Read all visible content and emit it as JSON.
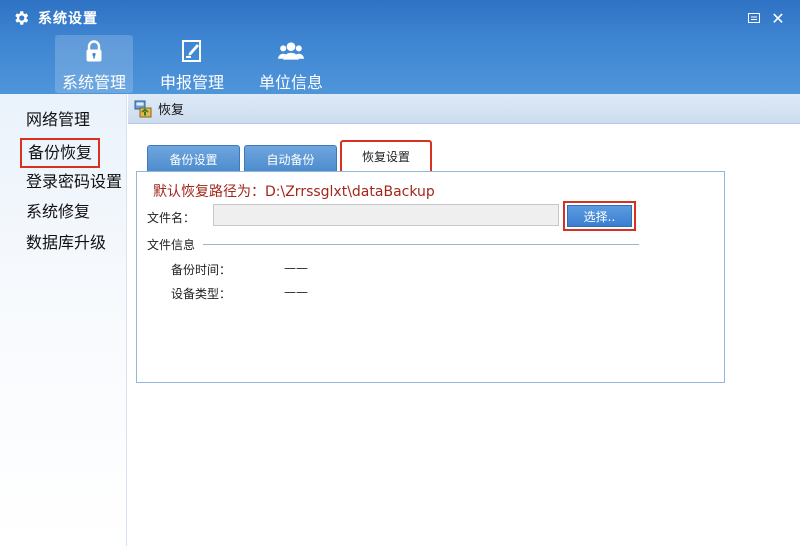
{
  "window": {
    "title": "系统设置",
    "gear_icon": "gear-icon",
    "menu_icon": "window-menu-icon",
    "close_glyph": "✕"
  },
  "nav": {
    "tabs": [
      {
        "label": "系统管理",
        "icon": "lock-icon",
        "active": true
      },
      {
        "label": "申报管理",
        "icon": "edit-doc-icon",
        "active": false
      },
      {
        "label": "单位信息",
        "icon": "users-icon",
        "active": false
      }
    ]
  },
  "sidebar": {
    "items": [
      {
        "label": "网络管理"
      },
      {
        "label": "备份恢复",
        "selected": true
      },
      {
        "label": "登录密码设置"
      },
      {
        "label": "系统修复"
      },
      {
        "label": "数据库升级"
      }
    ]
  },
  "content": {
    "title": "恢复",
    "icon": "restore-icon"
  },
  "tabs": [
    {
      "label": "备份设置"
    },
    {
      "label": "自动备份"
    },
    {
      "label": "恢复设置",
      "active": true
    }
  ],
  "restore": {
    "default_path": "默认恢复路径为：D:\\Zrrssglxt\\dataBackup",
    "file_label": "文件名：",
    "file_value": "",
    "select_label": "选择..",
    "fileinfo_label": "文件信息",
    "backup_time_label": "备份时间：",
    "backup_time_value": "——",
    "device_type_label": "设备类型：",
    "device_type_value": "——"
  },
  "colors": {
    "header_blue": "#3f86d2",
    "highlight_red": "#d6321f",
    "path_text": "#a1271a",
    "button_blue": "#3a7fcf"
  }
}
